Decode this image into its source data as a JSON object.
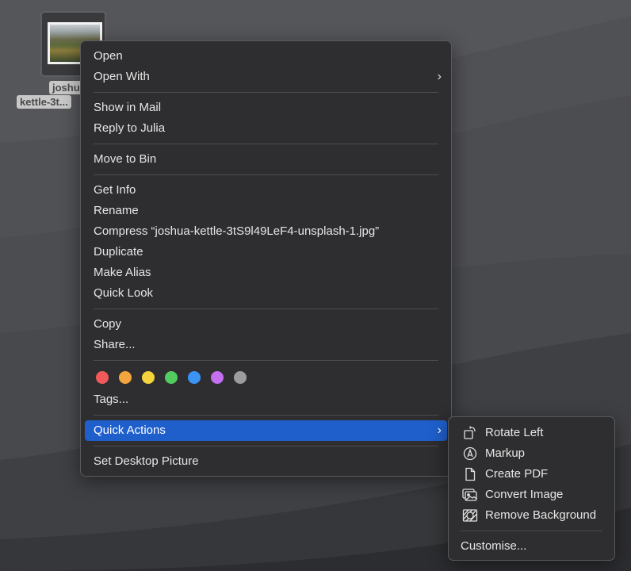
{
  "desktop": {
    "file": {
      "label_line1": "joshu",
      "label_line2": "kettle-3t..."
    }
  },
  "context_menu": {
    "groups": [
      [
        {
          "label": "Open"
        },
        {
          "label": "Open With",
          "submenu": true
        }
      ],
      [
        {
          "label": "Show in Mail"
        },
        {
          "label": "Reply to Julia"
        }
      ],
      [
        {
          "label": "Move to Bin"
        }
      ],
      [
        {
          "label": "Get Info"
        },
        {
          "label": "Rename"
        },
        {
          "label": "Compress “joshua-kettle-3tS9l49LeF4-unsplash-1.jpg”"
        },
        {
          "label": "Duplicate"
        },
        {
          "label": "Make Alias"
        },
        {
          "label": "Quick Look"
        }
      ],
      [
        {
          "label": "Copy"
        },
        {
          "label": "Share..."
        }
      ]
    ],
    "tag_colors": [
      {
        "name": "red",
        "color": "#f25a5a"
      },
      {
        "name": "orange",
        "color": "#f5a540"
      },
      {
        "name": "yellow",
        "color": "#f5d33d"
      },
      {
        "name": "green",
        "color": "#52cc5e"
      },
      {
        "name": "blue",
        "color": "#3b94f5"
      },
      {
        "name": "purple",
        "color": "#c46ef0"
      },
      {
        "name": "gray",
        "color": "#9c9c9e"
      }
    ],
    "tags_label": "Tags...",
    "quick_actions_label": "Quick Actions",
    "set_desktop_label": "Set Desktop Picture",
    "chevron": "›",
    "highlight_color": "#1f5fcc"
  },
  "quick_actions_menu": {
    "items": [
      {
        "label": "Rotate Left",
        "icon": "rotate-left-icon"
      },
      {
        "label": "Markup",
        "icon": "markup-icon"
      },
      {
        "label": "Create PDF",
        "icon": "document-icon"
      },
      {
        "label": "Convert Image",
        "icon": "photos-icon"
      },
      {
        "label": "Remove Background",
        "icon": "remove-background-icon"
      }
    ],
    "customise_label": "Customise..."
  }
}
